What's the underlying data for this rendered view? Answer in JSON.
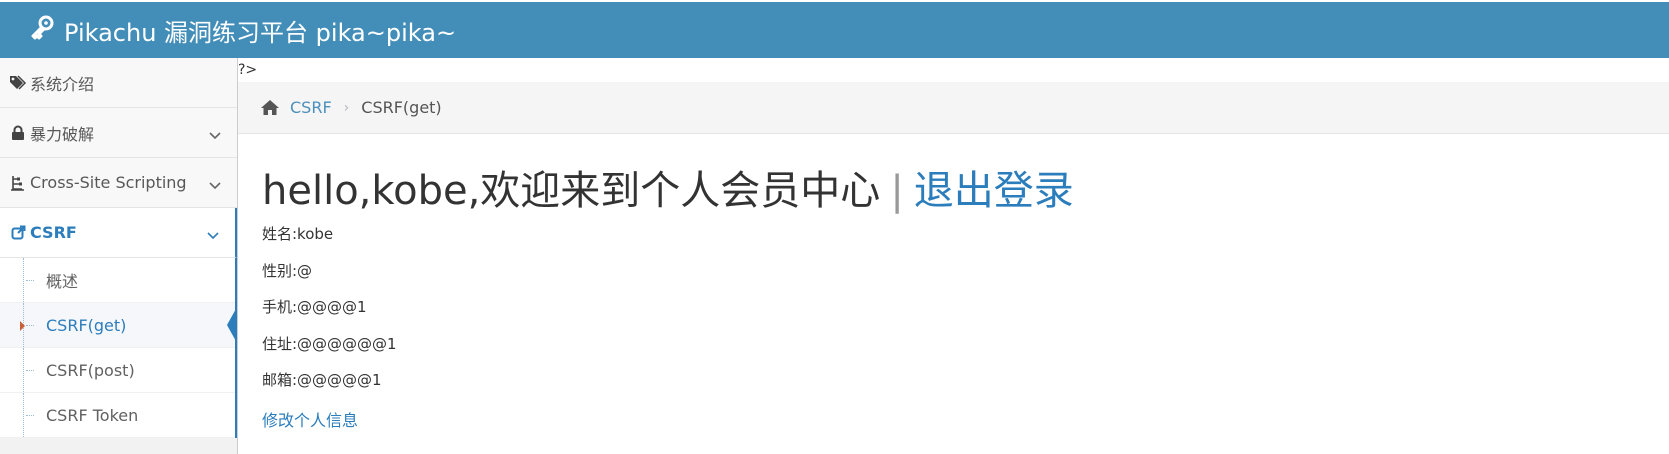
{
  "header": {
    "brand": "Pikachu 漏洞练习平台 pika~pika~"
  },
  "sidebar": {
    "items": [
      {
        "label": "系统介绍",
        "icon": "tag-icon"
      },
      {
        "label": "暴力破解",
        "icon": "lock-icon"
      },
      {
        "label": "Cross-Site Scripting",
        "icon": "tree-icon"
      },
      {
        "label": "CSRF",
        "icon": "external-link-icon"
      }
    ],
    "csrf_sub": [
      {
        "label": "概述"
      },
      {
        "label": "CSRF(get)"
      },
      {
        "label": "CSRF(post)"
      },
      {
        "label": "CSRF Token"
      }
    ]
  },
  "content": {
    "stray_text": "?>",
    "breadcrumb": {
      "parent": "CSRF",
      "current": "CSRF(get)"
    },
    "headline": {
      "greeting": "hello,kobe,欢迎来到个人会员中心",
      "divider": "|",
      "logout": "退出登录"
    },
    "profile": {
      "name": "姓名:kobe",
      "gender": "性别:@",
      "phone": "手机:@@@@1",
      "address": "住址:@@@@@@1",
      "email": "邮箱:@@@@@1"
    },
    "edit_link": "修改个人信息"
  },
  "colors": {
    "header_bg": "#438eb9",
    "link": "#2b7dbc",
    "active_marker": "#c86139"
  }
}
